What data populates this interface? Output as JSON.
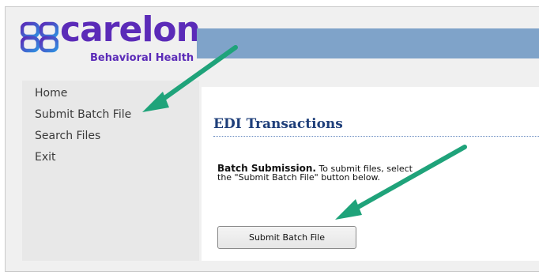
{
  "logo": {
    "brand": "carelon",
    "dot": ".",
    "subtitle": "Behavioral Health",
    "color": "#5b2bb8"
  },
  "banner": {
    "color": "#7fa3c9"
  },
  "sidebar": {
    "items": [
      {
        "label": "Home"
      },
      {
        "label": "Submit Batch File"
      },
      {
        "label": "Search Files"
      },
      {
        "label": "Exit"
      }
    ]
  },
  "main": {
    "title": "EDI Transactions",
    "description_bold": "Batch Submission.",
    "description_text": " To submit files, select the \"Submit Batch File\" button below.",
    "submit_button_label": "Submit Batch File"
  },
  "annotations": {
    "arrow_color": "#1fa37a",
    "arrow_icon": "callout-arrow-icon"
  }
}
